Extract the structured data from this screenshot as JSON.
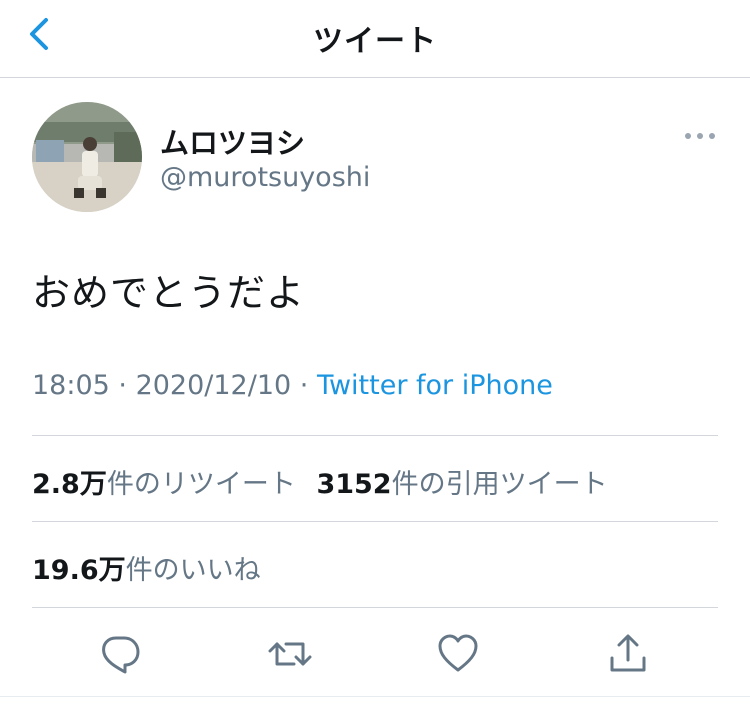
{
  "header": {
    "title": "ツイート"
  },
  "tweet": {
    "display_name": "ムロツヨシ",
    "handle": "@murotsuyoshi",
    "text": "おめでとうだよ",
    "time": "18:05",
    "date": "2020/12/10",
    "separator": " · ",
    "source": "Twitter for iPhone"
  },
  "stats": {
    "retweets_count": "2.8万",
    "retweets_label": "件のリツイート",
    "quotes_count": "3152",
    "quotes_label": "件の引用ツイート",
    "likes_count": "19.6万",
    "likes_label": "件のいいね"
  },
  "icons": {
    "back": "chevron-left-icon",
    "more": "more-horizontal-icon",
    "reply": "reply-icon",
    "retweet": "retweet-icon",
    "like": "heart-icon",
    "share": "share-icon"
  },
  "colors": {
    "accent": "#1b95e0",
    "secondary_text": "#657786",
    "primary_text": "#14171a",
    "divider": "#d3d6da"
  }
}
